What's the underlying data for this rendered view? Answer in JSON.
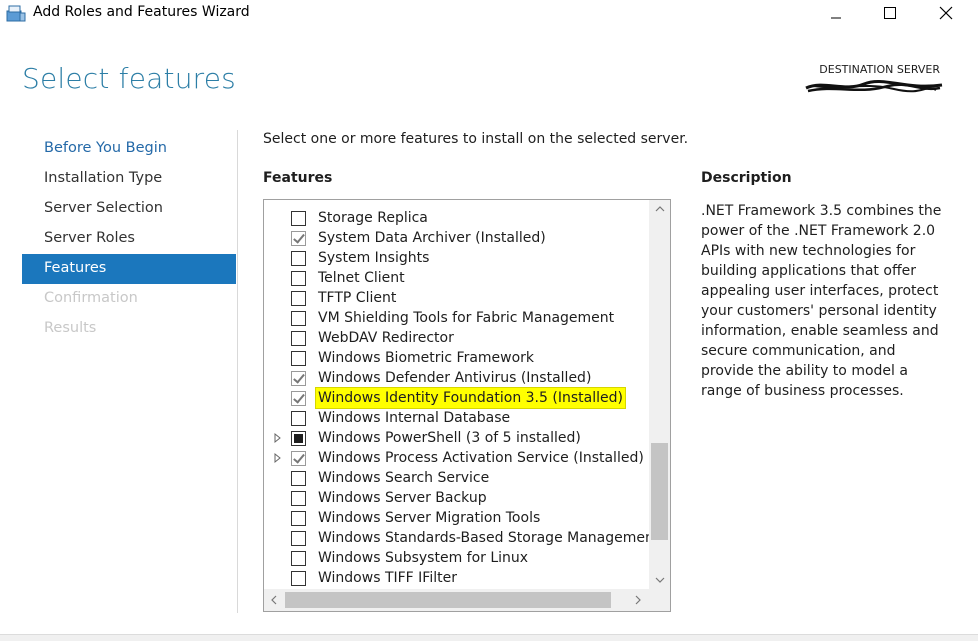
{
  "window": {
    "title": "Add Roles and Features Wizard",
    "icon": "server-manager-icon"
  },
  "page": {
    "title": "Select features",
    "destination_label": "DESTINATION SERVER"
  },
  "nav": {
    "items": [
      {
        "label": "Before You Begin",
        "state": "link"
      },
      {
        "label": "Installation Type",
        "state": "normal"
      },
      {
        "label": "Server Selection",
        "state": "normal"
      },
      {
        "label": "Server Roles",
        "state": "normal"
      },
      {
        "label": "Features",
        "state": "active"
      },
      {
        "label": "Confirmation",
        "state": "disabled"
      },
      {
        "label": "Results",
        "state": "disabled"
      }
    ]
  },
  "main": {
    "intro": "Select one or more features to install on the selected server.",
    "features_heading": "Features",
    "features": [
      {
        "label": "Storage Replica",
        "state": "unchecked",
        "expandable": false,
        "highlighted": false
      },
      {
        "label": "System Data Archiver (Installed)",
        "state": "checked",
        "expandable": false,
        "highlighted": false
      },
      {
        "label": "System Insights",
        "state": "unchecked",
        "expandable": false,
        "highlighted": false
      },
      {
        "label": "Telnet Client",
        "state": "unchecked",
        "expandable": false,
        "highlighted": false
      },
      {
        "label": "TFTP Client",
        "state": "unchecked",
        "expandable": false,
        "highlighted": false
      },
      {
        "label": "VM Shielding Tools for Fabric Management",
        "state": "unchecked",
        "expandable": false,
        "highlighted": false
      },
      {
        "label": "WebDAV Redirector",
        "state": "unchecked",
        "expandable": false,
        "highlighted": false
      },
      {
        "label": "Windows Biometric Framework",
        "state": "unchecked",
        "expandable": false,
        "highlighted": false
      },
      {
        "label": "Windows Defender Antivirus (Installed)",
        "state": "checked",
        "expandable": false,
        "highlighted": false
      },
      {
        "label": "Windows Identity Foundation 3.5 (Installed)",
        "state": "checked",
        "expandable": false,
        "highlighted": true
      },
      {
        "label": "Windows Internal Database",
        "state": "unchecked",
        "expandable": false,
        "highlighted": false
      },
      {
        "label": "Windows PowerShell (3 of 5 installed)",
        "state": "partial",
        "expandable": true,
        "highlighted": false
      },
      {
        "label": "Windows Process Activation Service (Installed)",
        "state": "checked",
        "expandable": true,
        "highlighted": false
      },
      {
        "label": "Windows Search Service",
        "state": "unchecked",
        "expandable": false,
        "highlighted": false
      },
      {
        "label": "Windows Server Backup",
        "state": "unchecked",
        "expandable": false,
        "highlighted": false
      },
      {
        "label": "Windows Server Migration Tools",
        "state": "unchecked",
        "expandable": false,
        "highlighted": false
      },
      {
        "label": "Windows Standards-Based Storage Management",
        "state": "unchecked",
        "expandable": false,
        "highlighted": false
      },
      {
        "label": "Windows Subsystem for Linux",
        "state": "unchecked",
        "expandable": false,
        "highlighted": false
      },
      {
        "label": "Windows TIFF IFilter",
        "state": "unchecked",
        "expandable": false,
        "highlighted": false
      }
    ]
  },
  "description": {
    "heading": "Description",
    "text": ".NET Framework 3.5 combines the power of the .NET Framework 2.0 APIs with new technologies for building applications that offer appealing user interfaces, protect your customers' personal identity information, enable seamless and secure communication, and provide the ability to model a range of business processes."
  },
  "colors": {
    "title_blue": "#2c7ea6",
    "nav_active": "#1b77bd",
    "link_blue": "#2469a8",
    "highlight": "#ffff00"
  }
}
